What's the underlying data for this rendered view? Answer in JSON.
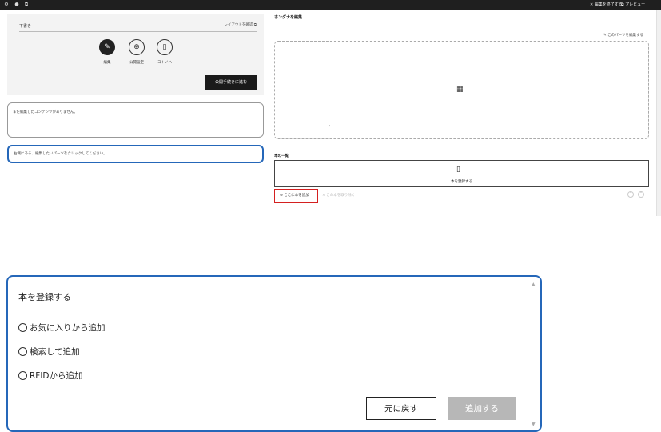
{
  "topbar": {
    "end_edit": "✕ 編集を終了する",
    "preview": "⧉ プレビュー"
  },
  "left": {
    "draft_label": "下書き",
    "layout_link": "レイアウトを確認 ⧉",
    "tools": [
      {
        "icon": "edit-icon",
        "label": "編集"
      },
      {
        "icon": "globe-icon",
        "label": "公開設定"
      },
      {
        "icon": "bookmark-icon",
        "label": "コトノハ"
      }
    ],
    "publish_button": "公開手続きに進む",
    "no_content_message": "まだ編集したコンテンツがありません。",
    "hint_message": "右側にある、編集したいパーツをクリックしてください。"
  },
  "right": {
    "title": "ホンダナを編集",
    "edit_part_link": "このパーツを編集する",
    "slash": "/",
    "books_title": "本の一覧",
    "register_label": "本を登録する",
    "add_here": "⊕ ここに本を追加",
    "remove_link": "× この本を取り除く"
  },
  "dialog": {
    "title": "本を登録する",
    "options": [
      "お気に入りから追加",
      "検索して追加",
      "RFIDから追加"
    ],
    "back_button": "元に戻す",
    "add_button": "追加する"
  },
  "colors": {
    "accent_blue": "#2567b9",
    "highlight_red": "#d42020",
    "dark": "#1a1a1a",
    "disabled_gray": "#b7b7b7"
  }
}
